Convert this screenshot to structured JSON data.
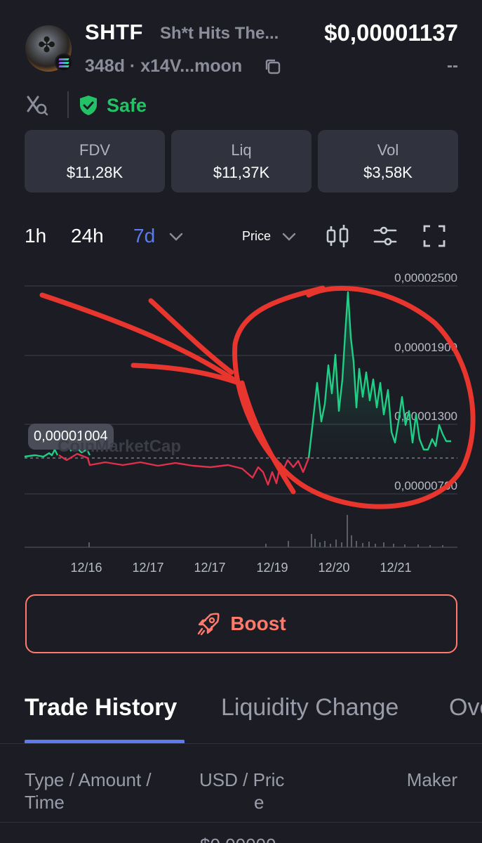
{
  "header": {
    "symbol": "SHTF",
    "full_name": "Sh*t Hits The...",
    "price": "$0,00001137",
    "age_address": "348d · x14V...moon",
    "change": "--",
    "safety": "Safe"
  },
  "stats": [
    {
      "label": "FDV",
      "value": "$11,28K"
    },
    {
      "label": "Liq",
      "value": "$11,37K"
    },
    {
      "label": "Vol",
      "value": "$3,58K"
    }
  ],
  "timeframes": [
    "1h",
    "24h",
    "7d"
  ],
  "active_timeframe": "7d",
  "price_toggle": "Price",
  "chart_data": {
    "type": "line",
    "y_axis_labels": [
      "0,00002500",
      "0,00001900",
      "0,00001300",
      "0,00000700"
    ],
    "x_axis_labels": [
      "12/16",
      "12/17",
      "12/17",
      "12/19",
      "12/20",
      "12/21"
    ],
    "reference_value": "0,00001004",
    "watermark": "CoinMarketCap",
    "colors": {
      "up": "#1fcf85",
      "down": "#e0304a",
      "annotation": "#e8352e"
    }
  },
  "boost_label": "Boost",
  "tabs": [
    "Trade History",
    "Liquidity Change",
    "Ove"
  ],
  "table": {
    "col_type": [
      "Type / Amount /",
      "Time"
    ],
    "col_usd": [
      "USD / Pric",
      "e"
    ],
    "col_maker": "Maker",
    "first_row_partial": "$0.00000"
  }
}
